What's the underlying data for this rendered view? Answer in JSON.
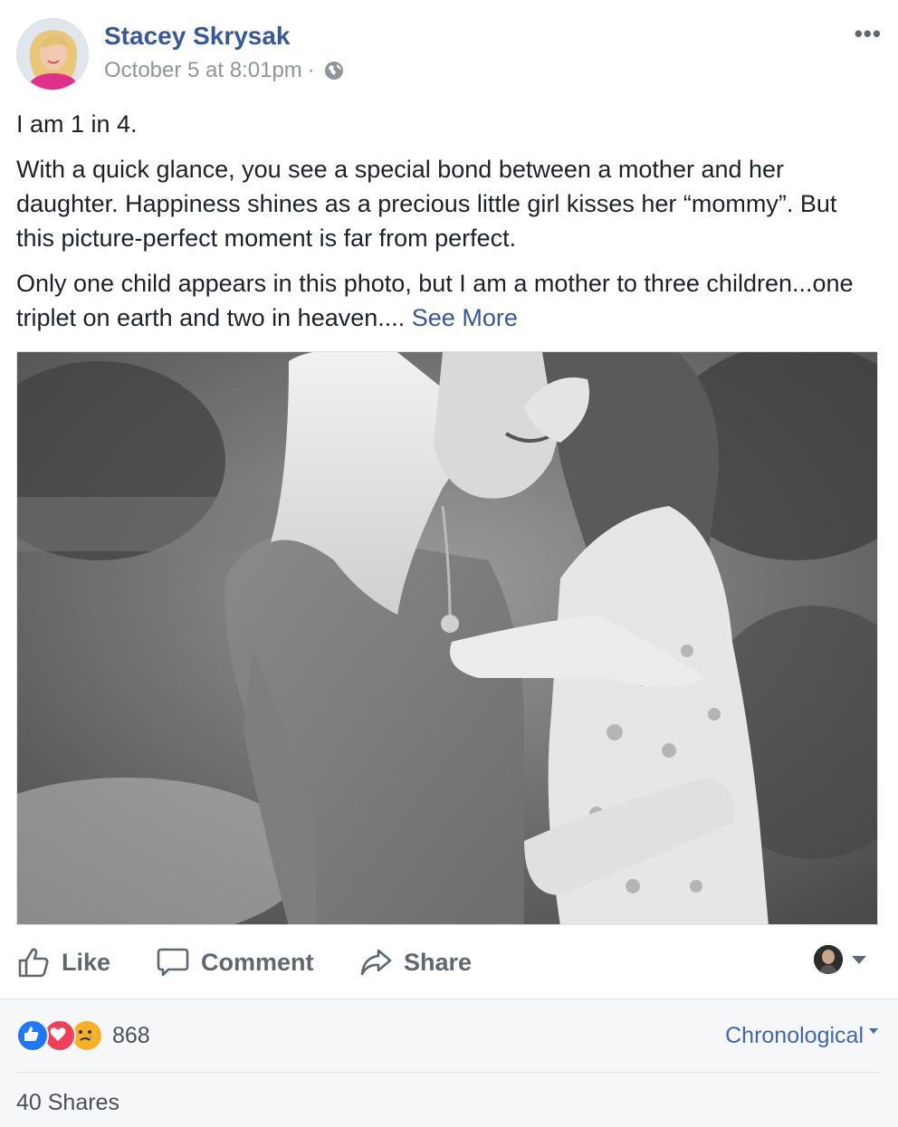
{
  "post": {
    "author": "Stacey Skrysak",
    "timestamp": "October 5 at 8:01pm",
    "separator": "·",
    "privacy_icon": "globe-icon",
    "more_label": "•••",
    "paragraphs": [
      "I am 1 in 4.",
      "With a quick glance, you see a special bond between a mother and her daughter. Happiness shines as a precious little girl kisses her “mommy”. But this picture-perfect moment is far from perfect.",
      "Only one child appears in this photo, but I am a mother to three children...one triplet on earth and two in heaven.... "
    ],
    "see_more": "See More",
    "photo_icon": "photo-mother-daughter"
  },
  "actions": {
    "like": "Like",
    "comment": "Comment",
    "share": "Share"
  },
  "footer": {
    "reaction_icons": [
      "like-reaction-icon",
      "love-reaction-icon",
      "sad-reaction-icon"
    ],
    "reaction_count": "868",
    "sort_label": "Chronological",
    "shares_label": "40 Shares"
  },
  "colors": {
    "link": "#365899",
    "muted": "#90949c",
    "action": "#606770",
    "like_blue": "#2078f4",
    "love_red": "#f33e58",
    "sad_yellow": "#f7b125",
    "footer_bg": "#f6f7f9"
  }
}
